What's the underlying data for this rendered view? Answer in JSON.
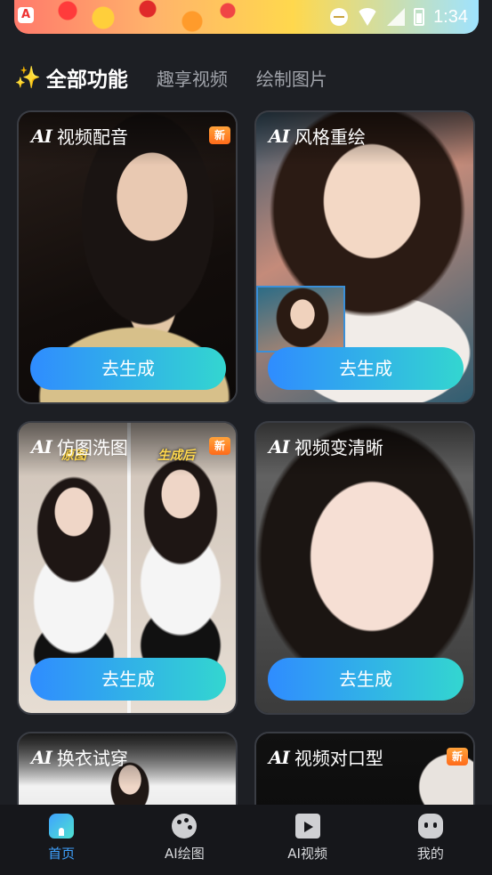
{
  "status_bar": {
    "time": "1:34"
  },
  "banner": {
    "logo_text": "A"
  },
  "tabs": [
    {
      "label": "全部功能",
      "active": true
    },
    {
      "label": "趣享视频",
      "active": false
    },
    {
      "label": "绘制图片",
      "active": false
    }
  ],
  "ai_mark": "AI",
  "cards": [
    {
      "title": "视频配音",
      "badge": "新",
      "button": "去生成"
    },
    {
      "title": "风格重绘",
      "badge": "",
      "button": "去生成"
    },
    {
      "title": "仿图洗图",
      "badge": "新",
      "button": "去生成",
      "labels": {
        "left": "原图",
        "right": "生成后"
      }
    },
    {
      "title": "视频变清晰",
      "badge": "",
      "button": "去生成"
    },
    {
      "title": "换衣试穿",
      "badge": "",
      "button": ""
    },
    {
      "title": "视频对口型",
      "badge": "新",
      "button": ""
    }
  ],
  "bottom_nav": [
    {
      "label": "首页",
      "icon": "home-icon",
      "active": true
    },
    {
      "label": "AI绘图",
      "icon": "palette-icon",
      "active": false
    },
    {
      "label": "AI视频",
      "icon": "clapper-icon",
      "active": false
    },
    {
      "label": "我的",
      "icon": "profile-icon",
      "active": false
    }
  ],
  "colors": {
    "accent": "#3fa2ff",
    "button_gradient_start": "#2f8cff",
    "button_gradient_end": "#33d6d0",
    "badge": "#ff7a1a",
    "background": "#1d1f24"
  }
}
